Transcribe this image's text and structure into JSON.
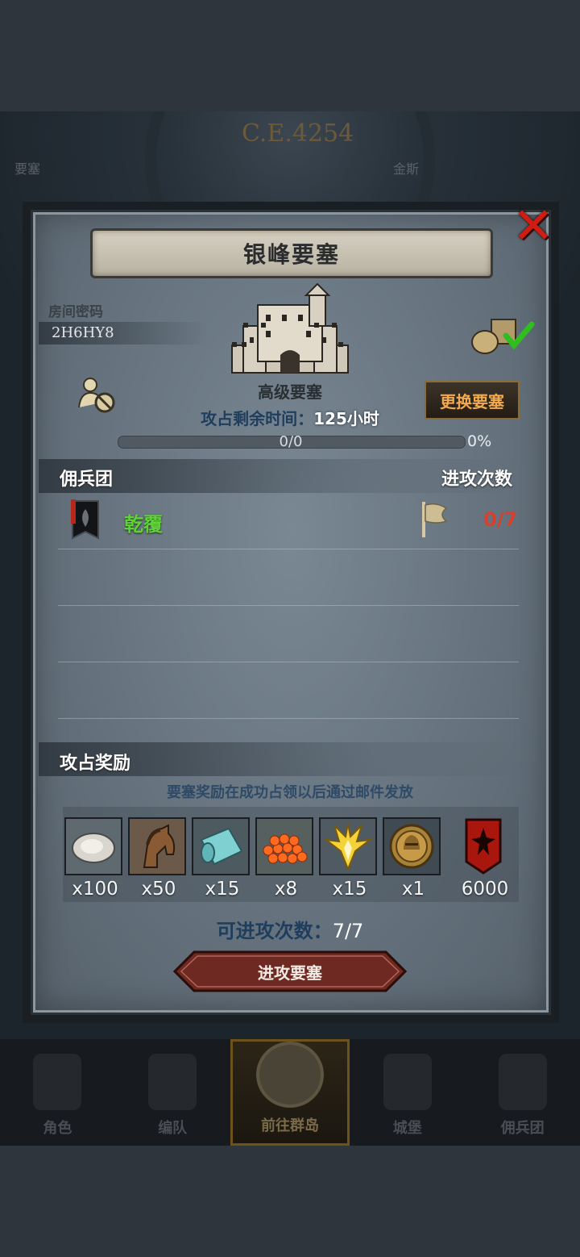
{
  "background": {
    "era_label": "C.E.4254",
    "left_label": "要塞",
    "right_label": "金斯"
  },
  "dialog": {
    "title": "银峰要塞",
    "room_password_label": "房间密码",
    "room_password_value": "2H6HY8",
    "fortress_type": "高级要塞",
    "change_fortress_label": "更换要塞",
    "time_left_label": "攻占剩余时间：",
    "time_left_value": "125小时",
    "progress_text": "0/0",
    "progress_percent_text": "0%",
    "progress_fraction": 0,
    "mercenary_header": "佣兵团",
    "attack_count_header": "进攻次数",
    "mercenaries": [
      {
        "name": "乾覆",
        "attacks": "0/7"
      }
    ],
    "rewards_header": "攻占奖励",
    "rewards_note": "要塞奖励在成功占领以后通过邮件发放",
    "rewards": [
      {
        "icon": "oyster-icon",
        "qty": "x100"
      },
      {
        "icon": "horse-icon",
        "qty": "x50"
      },
      {
        "icon": "cloth-icon",
        "qty": "x15"
      },
      {
        "icon": "roe-icon",
        "qty": "x8"
      },
      {
        "icon": "golden-crest-icon",
        "qty": "x15"
      },
      {
        "icon": "knight-medal-icon",
        "qty": "x1"
      },
      {
        "icon": "red-banner-icon",
        "qty": "6000"
      }
    ],
    "attacks_left_label": "可进攻次数：",
    "attacks_left_value": "7/7",
    "attack_button_label": "进攻要塞"
  },
  "bottom_nav": [
    {
      "label": "角色",
      "active": false
    },
    {
      "label": "编队",
      "active": false
    },
    {
      "label": "前往群岛",
      "active": true
    },
    {
      "label": "城堡",
      "active": false
    },
    {
      "label": "佣兵团",
      "active": false
    }
  ],
  "colors": {
    "accent_orange": "#f3a94e",
    "merc_green": "#5fd23a",
    "count_red": "#d6402c",
    "close_red": "#d11c12"
  }
}
